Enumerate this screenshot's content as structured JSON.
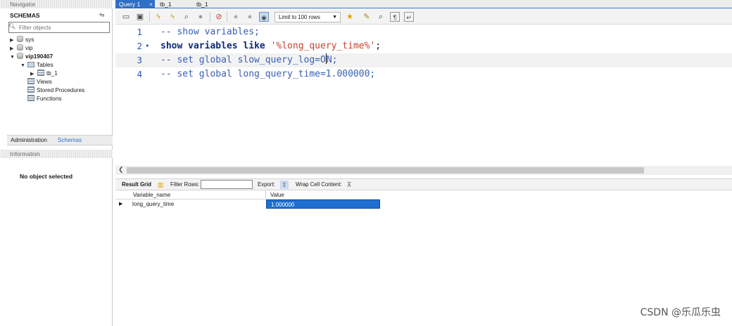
{
  "navigator": {
    "header": "Navigator",
    "schemas_title": "SCHEMAS",
    "filter_placeholder": "Filter objects",
    "tree": {
      "sys": "sys",
      "vip": "vip",
      "vip190407": "vip190407",
      "tables": "Tables",
      "tb_1": "tb_1",
      "views": "Views",
      "stored_procedures": "Stored Procedures",
      "functions": "Functions"
    },
    "tabs": {
      "administration": "Administration",
      "schemas": "Schemas"
    },
    "info_header": "Information",
    "no_object": "No object selected"
  },
  "query_tabs": {
    "tab1": "Query 1",
    "tab1_close": "×",
    "tab2": "tb_1",
    "tab3": "tb_1"
  },
  "toolbar": {
    "limit_label": "Limit to 100 rows",
    "icons": [
      "folder-open",
      "save",
      "execute",
      "execute-current",
      "explain",
      "stop",
      "toggle-error",
      "commit",
      "rollback",
      "autocommit",
      "limit",
      "beautify",
      "find",
      "invisible-chars",
      "wrap"
    ]
  },
  "editor": {
    "lines": [
      {
        "num": "1",
        "text": "-- show variables;"
      },
      {
        "num": "2",
        "kw1": "show",
        "kw2": "variables",
        "kw3": "like",
        "str": "'%long_query_time%'",
        "end": ";"
      },
      {
        "num": "3",
        "before_cursor": "-- set global slow_query_log=O",
        "after_cursor": "N;"
      },
      {
        "num": "4",
        "text": "-- set global long_query_time=1.000000;"
      }
    ],
    "current_line": 3
  },
  "result": {
    "result_grid": "Result Grid",
    "filter_rows": "Filter Rows:",
    "export": "Export:",
    "wrap_cell": "Wrap Cell Content:",
    "columns": [
      "Variable_name",
      "Value"
    ],
    "rows": [
      {
        "variable_name": "long_query_time",
        "value": "1.000000"
      }
    ]
  },
  "watermark": "CSDN @乐瓜乐虫"
}
